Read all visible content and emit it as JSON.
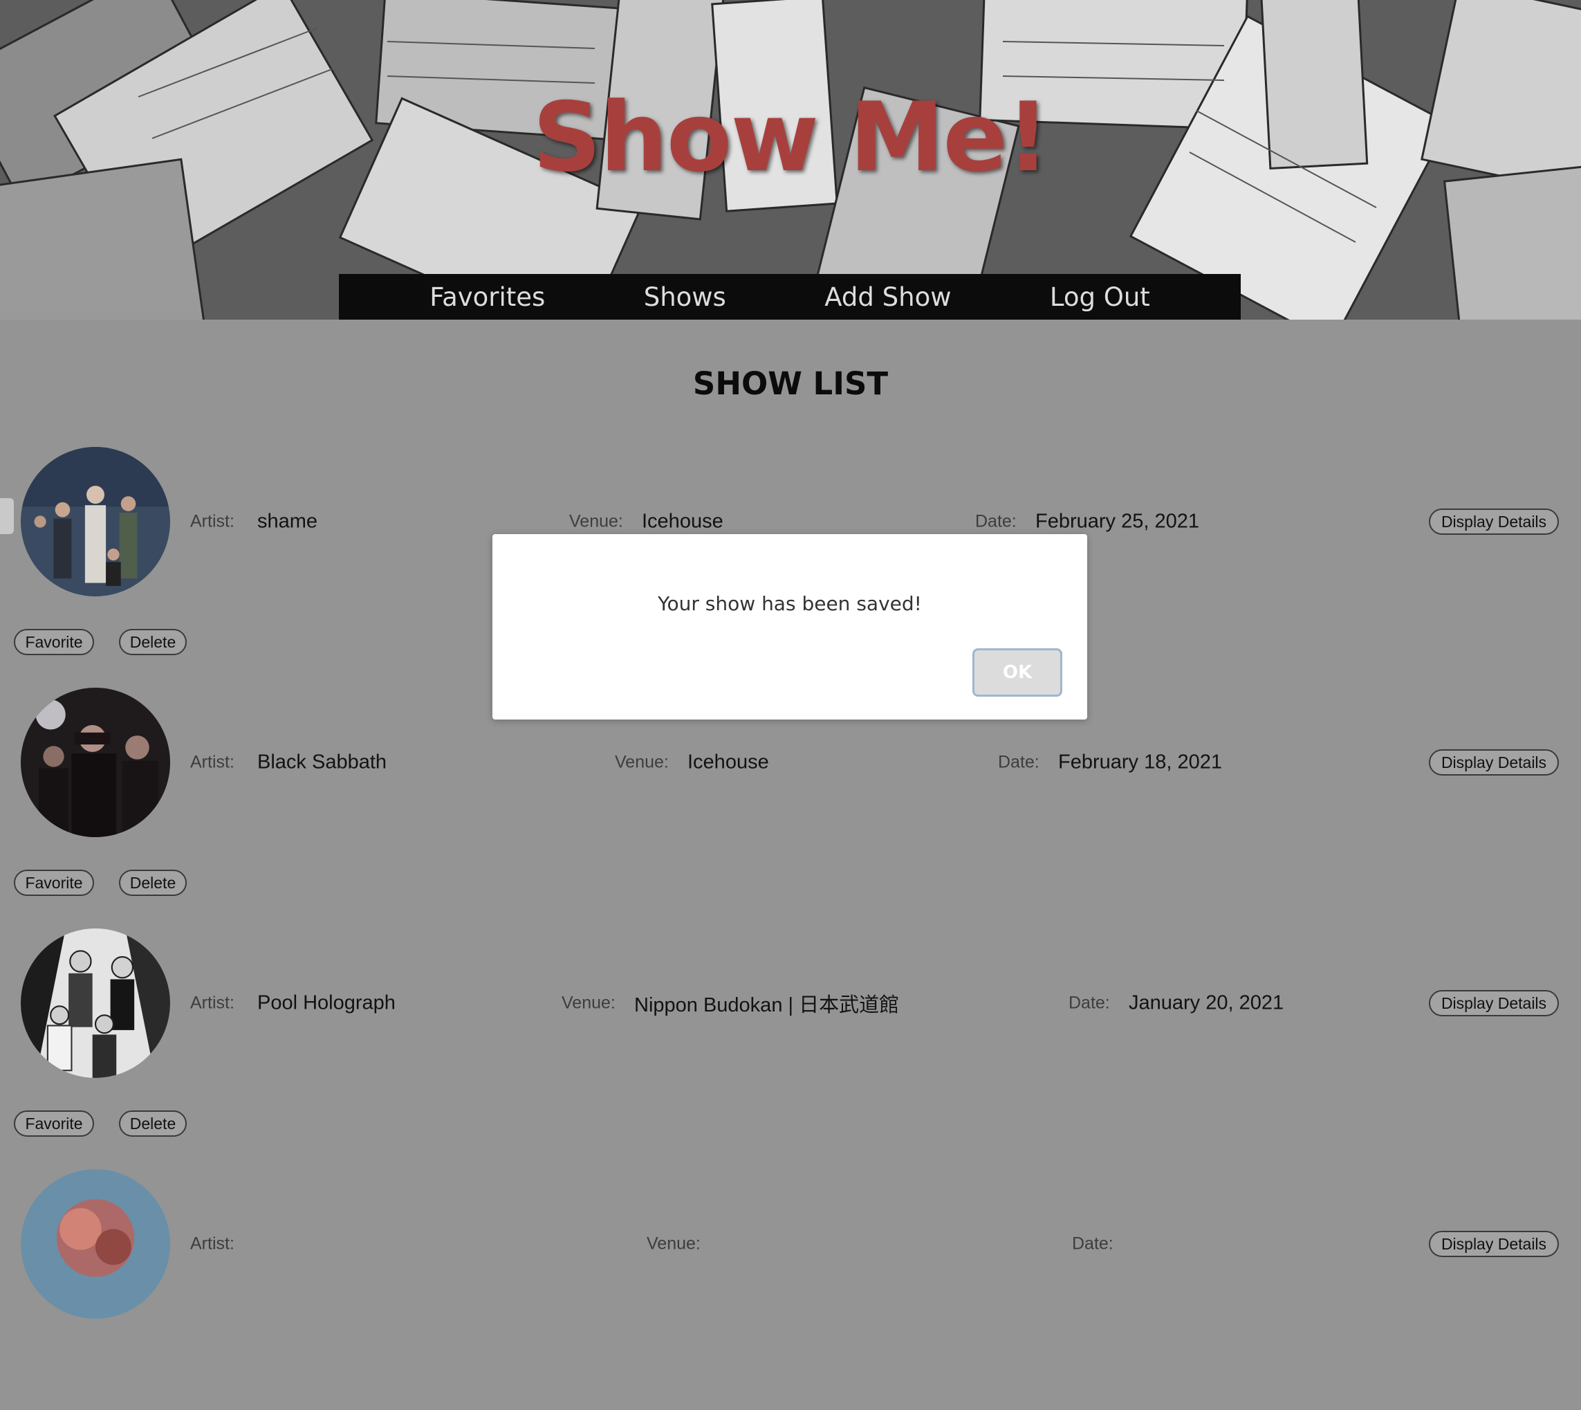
{
  "header": {
    "brand": "Show Me!",
    "nav": [
      {
        "label": "Favorites"
      },
      {
        "label": "Shows"
      },
      {
        "label": "Add Show"
      },
      {
        "label": "Log Out"
      }
    ]
  },
  "list": {
    "title": "SHOW LIST",
    "artist_label": "Artist:",
    "venue_label": "Venue:",
    "date_label": "Date:",
    "details_label": "Display Details",
    "favorite_label": "Favorite",
    "delete_label": "Delete",
    "shows": [
      {
        "artist": "shame",
        "venue": "Icehouse",
        "date": "February 25, 2021"
      },
      {
        "artist": "Black Sabbath",
        "venue": "Icehouse",
        "date": "February 18, 2021"
      },
      {
        "artist": "Pool Holograph",
        "venue": "Nippon Budokan | 日本武道館",
        "date": "January 20, 2021"
      },
      {
        "artist": "",
        "venue": "",
        "date": ""
      }
    ]
  },
  "dialog": {
    "message": "Your show has been saved!",
    "ok_label": "OK"
  },
  "colors": {
    "page_bg": "#949494",
    "brand_red": "#a7403d",
    "nav_bg": "#0c0c0c"
  }
}
